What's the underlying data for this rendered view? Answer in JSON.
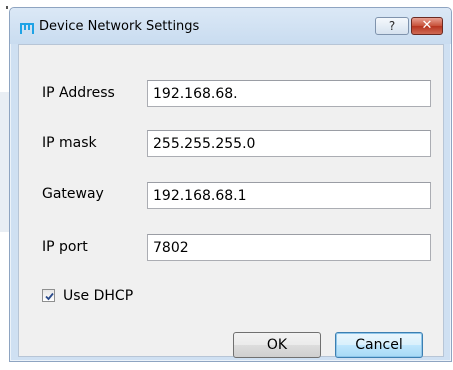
{
  "window": {
    "title": "Device Network Settings",
    "help_label": "?",
    "close_label": "✕"
  },
  "form": {
    "ip_address": {
      "label": "IP Address",
      "value": "192.168.68."
    },
    "ip_mask": {
      "label": "IP mask",
      "value": "255.255.255.0"
    },
    "gateway": {
      "label": "Gateway",
      "value": "192.168.68.1"
    },
    "ip_port": {
      "label": "IP port",
      "value": "7802"
    },
    "use_dhcp": {
      "label": "Use DHCP",
      "checked": true
    }
  },
  "buttons": {
    "ok_label": "OK",
    "cancel_label": "Cancel"
  },
  "colors": {
    "icon_accent": "#1fa3e6",
    "titlebar": "#cfe0f2",
    "close_button": "#c75038"
  },
  "icons": {
    "app": "device-logo-icon",
    "checkmark": "checkmark-icon"
  }
}
